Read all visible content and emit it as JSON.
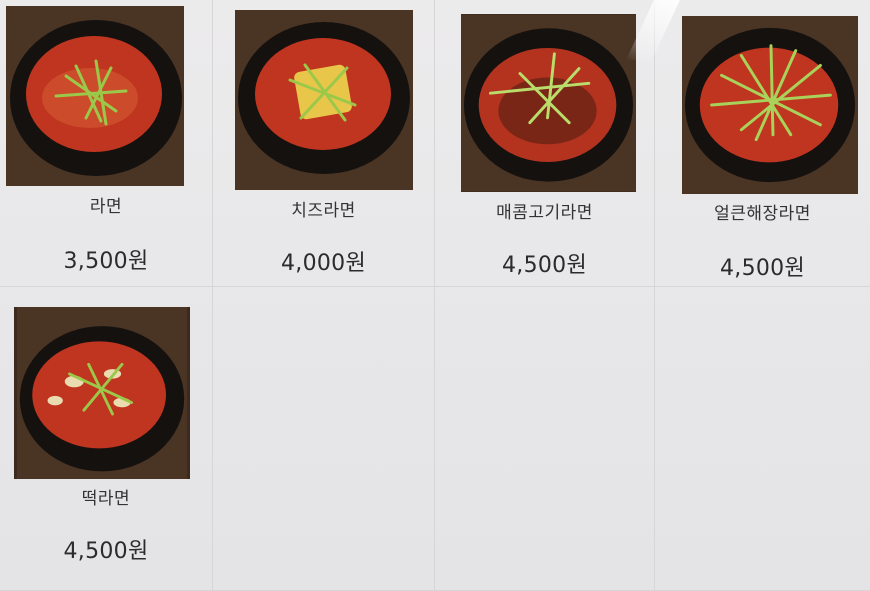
{
  "menu": {
    "items": [
      {
        "name": "라면",
        "price": "3,500원",
        "image_icon": "ramen-photo"
      },
      {
        "name": "치즈라면",
        "price": "4,000원",
        "image_icon": "cheese-ramen-photo"
      },
      {
        "name": "매콤고기라면",
        "price": "4,500원",
        "image_icon": "spicy-meat-ramen-photo"
      },
      {
        "name": "얼큰해장라면",
        "price": "4,500원",
        "image_icon": "hangover-ramen-photo"
      },
      {
        "name": "떡라면",
        "price": "4,500원",
        "image_icon": "rice-cake-ramen-photo"
      }
    ]
  },
  "colors": {
    "bowl": "#15110f",
    "soup": "#c0351f",
    "scallion": "#9cc84a",
    "background": "#e9e9ea"
  }
}
